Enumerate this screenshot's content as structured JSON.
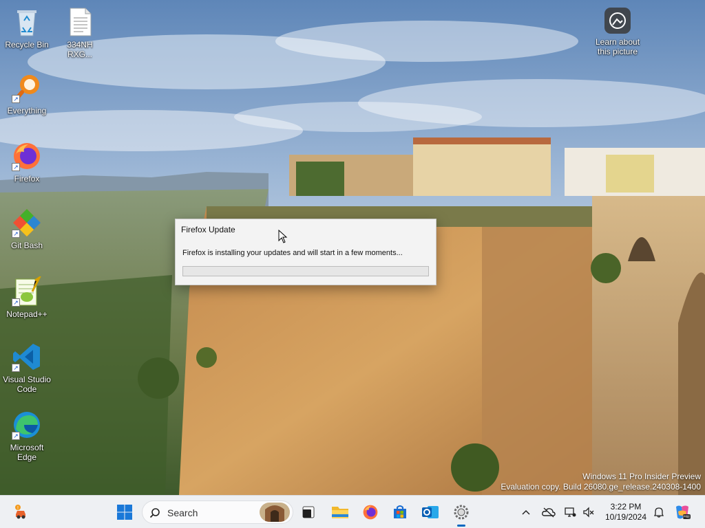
{
  "desktop": {
    "icons": [
      {
        "label": "Recycle Bin",
        "icon": "recycle-bin-icon"
      },
      {
        "label": "334NH RXG...",
        "icon": "text-file-icon"
      },
      {
        "label": "Everything",
        "icon": "everything-search-icon"
      },
      {
        "label": "Firefox",
        "icon": "firefox-icon"
      },
      {
        "label": "Git Bash",
        "icon": "git-bash-icon"
      },
      {
        "label": "Notepad++",
        "icon": "notepad-plus-plus-icon"
      },
      {
        "label": "Visual Studio Code",
        "icon": "vscode-icon"
      },
      {
        "label": "Microsoft Edge",
        "icon": "edge-icon"
      }
    ],
    "spotlight": {
      "label": "Learn about this picture",
      "icon": "camera-icon"
    },
    "watermark": {
      "line1": "Windows 11 Pro Insider Preview",
      "line2": "Evaluation copy. Build 26080.ge_release.240308-1400"
    }
  },
  "dialog": {
    "title": "Firefox Update",
    "message": "Firefox is installing your updates and will start in a few moments...",
    "progress": 0
  },
  "taskbar": {
    "search_label": "Search",
    "apps": [
      "widgets-icon",
      "start-icon",
      "task-view-icon",
      "file-explorer-icon",
      "firefox-icon",
      "microsoft-store-icon",
      "outlook-icon",
      "settings-icon"
    ],
    "tray": [
      "chevron-up-icon",
      "onedrive-icon",
      "network-icon",
      "volume-muted-icon",
      "notification-icon",
      "copilot-icon"
    ],
    "time": "3:22 PM",
    "date": "10/19/2024"
  },
  "colors": {
    "accent": "#0067c0",
    "dialog_bg": "#f3f3f3",
    "taskbar_bg": "#eef0f3"
  }
}
